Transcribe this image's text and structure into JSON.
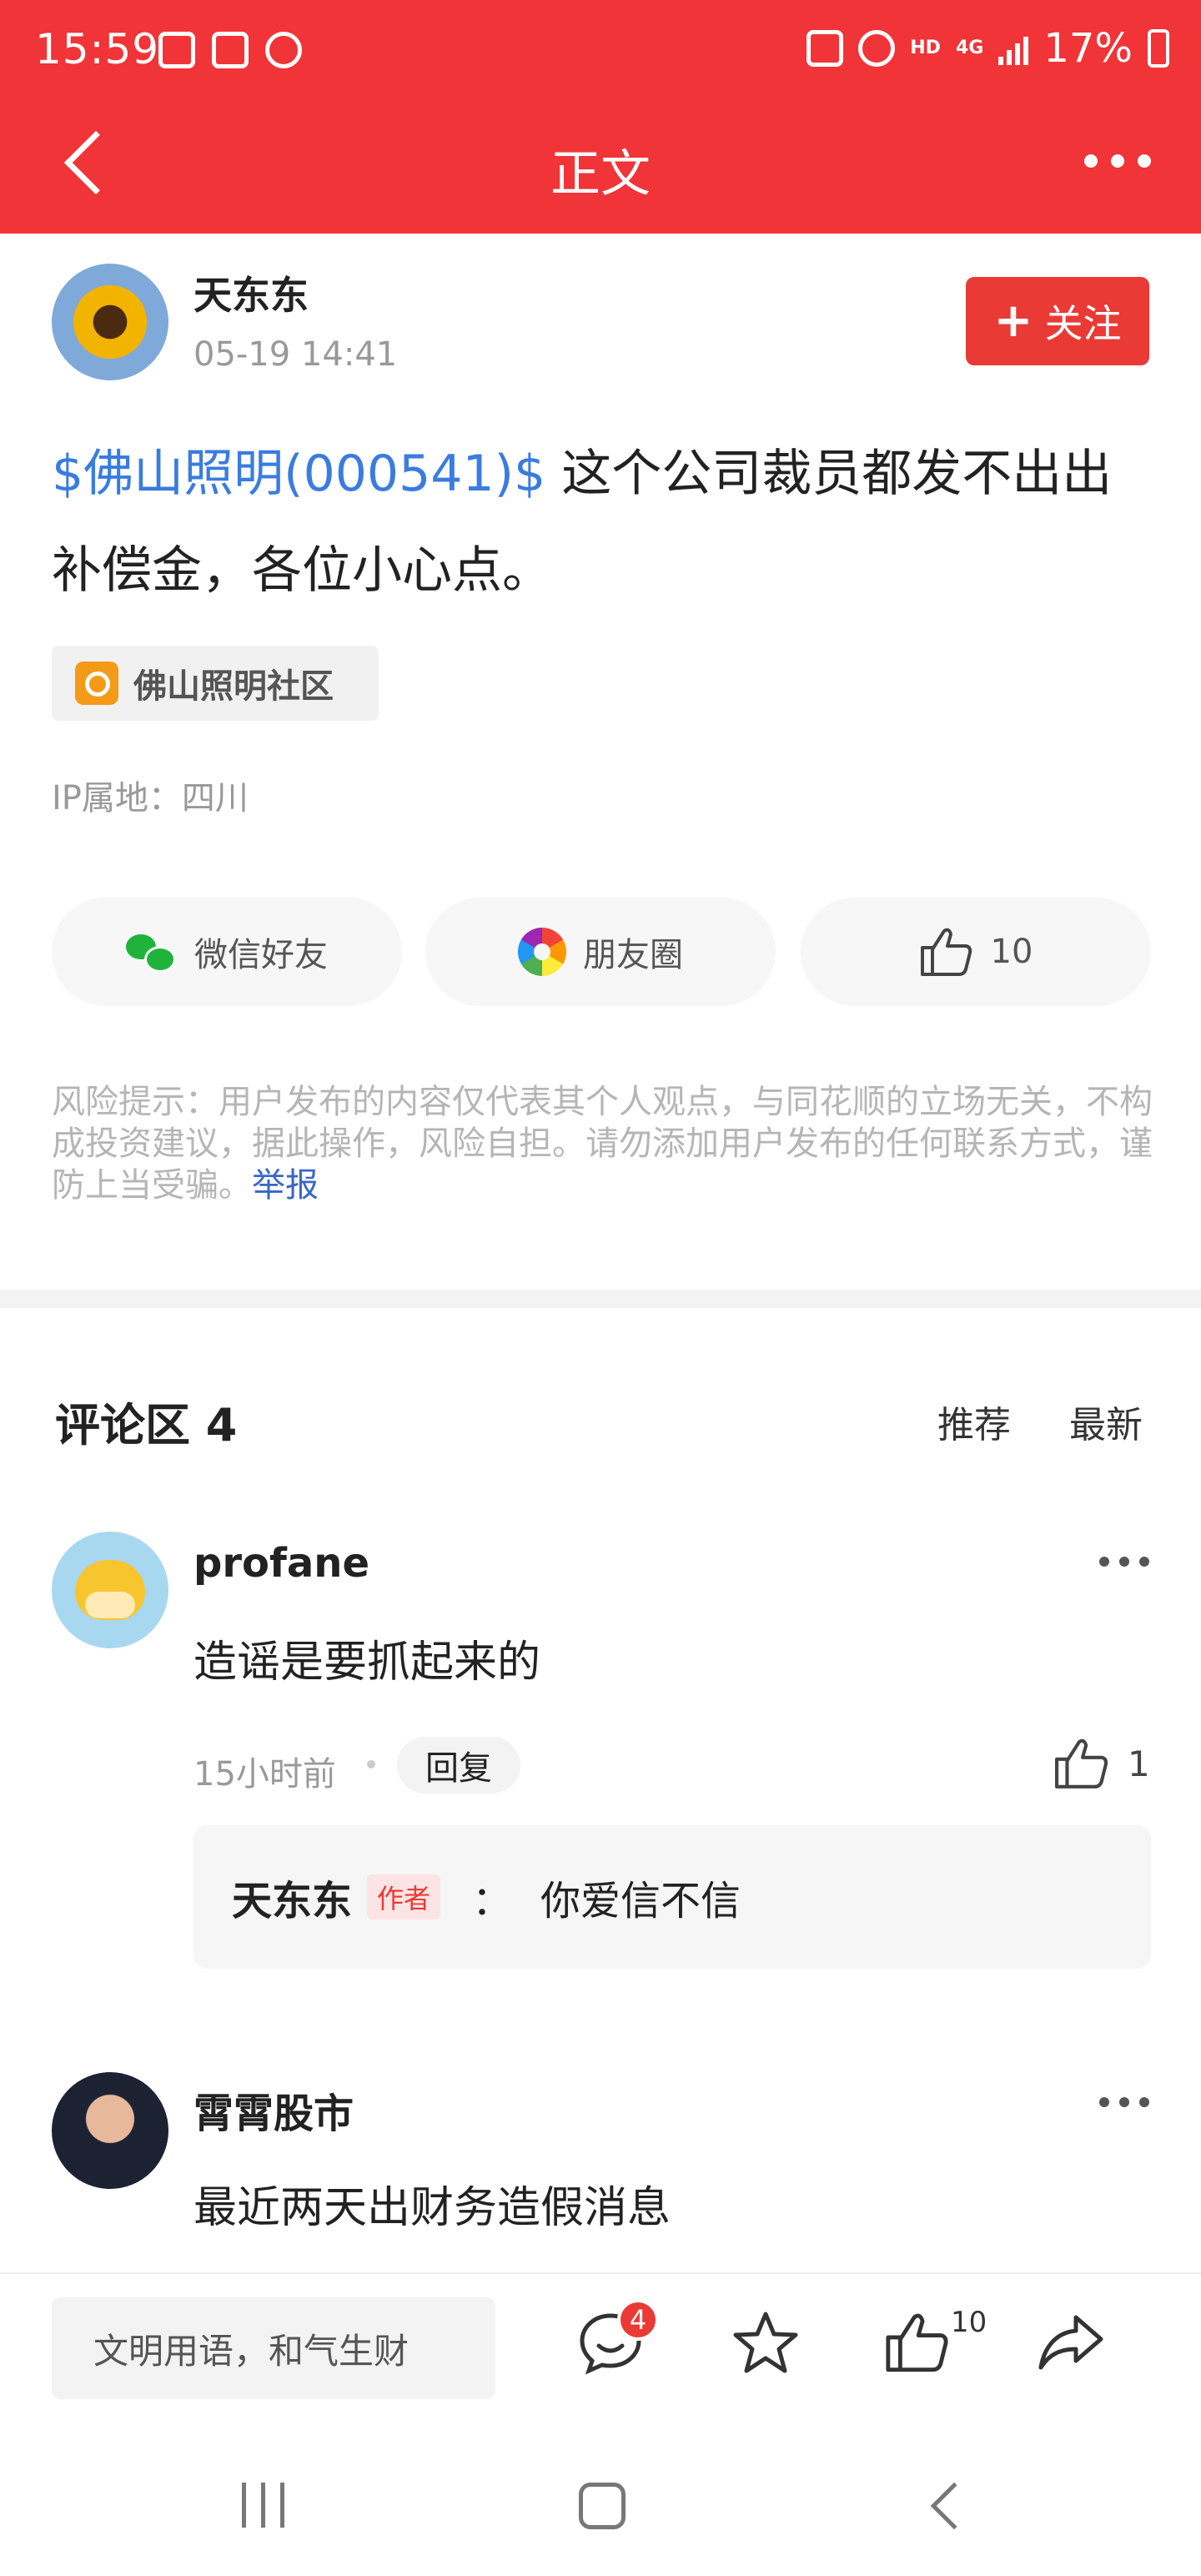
{
  "status_bar": {
    "time": "15:59",
    "network": "4G",
    "hd": "HD",
    "battery": "17%"
  },
  "nav": {
    "title": "正文"
  },
  "post": {
    "author": "天东东",
    "date": "05-19 14:41",
    "follow_label": "关注",
    "follow_icon": "plus-icon",
    "stock_link": "$佛山照明(000541)$",
    "content": " 这个公司裁员都发不出出补偿金，各位小心点。",
    "community_tag": "佛山照明社区",
    "ip_location": "IP属地：四川"
  },
  "share": {
    "wechat_label": "微信好友",
    "moments_label": "朋友圈",
    "like_count": "10"
  },
  "risk": {
    "text": "风险提示：用户发布的内容仅代表其个人观点，与同花顺的立场无关，不构成投资建议，据此操作，风险自担。请勿添加用户发布的任何联系方式，谨防上当受骗。",
    "report_label": "举报"
  },
  "comments": {
    "title": "评论区 4",
    "sort_recommend": "推荐",
    "sort_latest": "最新",
    "items": [
      {
        "user": "profane",
        "text": "造谣是要抓起来的",
        "time": "15小时前",
        "reply_label": "回复",
        "likes": "1",
        "reply": {
          "name": "天东东",
          "badge": "作者",
          "colon": "：",
          "text": "你爱信不信"
        }
      },
      {
        "user": "霄霄股市",
        "text": "最近两天出财务造假消息"
      }
    ]
  },
  "bottom_bar": {
    "input_placeholder": "文明用语，和气生财",
    "comment_badge": "4",
    "like_count": "10"
  },
  "colors": {
    "brand_red": "#f03437",
    "link_blue": "#3a7ce0",
    "tag_orange": "#f59a18"
  }
}
